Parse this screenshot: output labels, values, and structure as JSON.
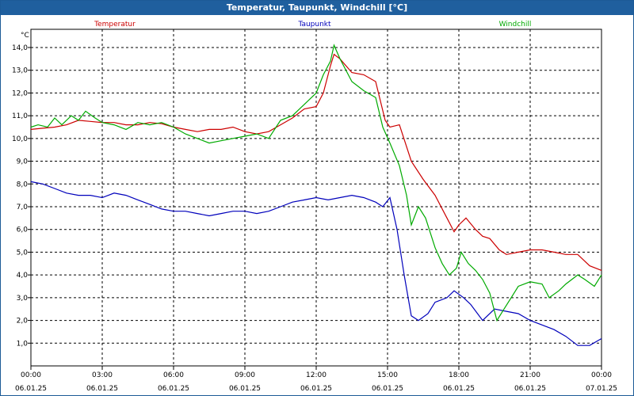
{
  "window": {
    "title": "Temperatur, Taupunkt, Windchill [°C]"
  },
  "chart_data": {
    "type": "line",
    "title": "Temperatur, Taupunkt, Windchill [°C]",
    "ylabel": "°C",
    "ylim": [
      0,
      14.8
    ],
    "xlim": [
      0,
      24
    ],
    "grid": true,
    "legend_placement": "top",
    "x_ticks": [
      {
        "hour": 0,
        "time": "00:00",
        "date": "06.01.25"
      },
      {
        "hour": 3,
        "time": "03:00",
        "date": "06.01.25"
      },
      {
        "hour": 6,
        "time": "06:00",
        "date": "06.01.25"
      },
      {
        "hour": 9,
        "time": "09:00",
        "date": "06.01.25"
      },
      {
        "hour": 12,
        "time": "12:00",
        "date": "06.01.25"
      },
      {
        "hour": 15,
        "time": "15:00",
        "date": "06.01.25"
      },
      {
        "hour": 18,
        "time": "18:00",
        "date": "06.01.25"
      },
      {
        "hour": 21,
        "time": "21:00",
        "date": "06.01.25"
      },
      {
        "hour": 24,
        "time": "00:00",
        "date": "07.01.25"
      }
    ],
    "y_ticks": [
      "1,0",
      "2,0",
      "3,0",
      "4,0",
      "5,0",
      "6,0",
      "7,0",
      "8,0",
      "9,0",
      "10,0",
      "11,0",
      "12,0",
      "13,0",
      "14,0"
    ],
    "series": [
      {
        "name": "Temperatur",
        "color": "#cc0000",
        "points": [
          [
            0,
            10.4
          ],
          [
            0.5,
            10.45
          ],
          [
            1,
            10.5
          ],
          [
            1.5,
            10.6
          ],
          [
            2,
            10.8
          ],
          [
            2.5,
            10.75
          ],
          [
            3,
            10.7
          ],
          [
            3.5,
            10.7
          ],
          [
            4,
            10.6
          ],
          [
            4.5,
            10.6
          ],
          [
            5,
            10.7
          ],
          [
            5.5,
            10.65
          ],
          [
            6,
            10.5
          ],
          [
            6.5,
            10.4
          ],
          [
            7,
            10.3
          ],
          [
            7.5,
            10.4
          ],
          [
            8,
            10.4
          ],
          [
            8.5,
            10.5
          ],
          [
            9,
            10.3
          ],
          [
            9.5,
            10.2
          ],
          [
            10,
            10.3
          ],
          [
            10.5,
            10.6
          ],
          [
            11,
            10.9
          ],
          [
            11.5,
            11.3
          ],
          [
            12,
            11.4
          ],
          [
            12.3,
            12.0
          ],
          [
            12.6,
            13.2
          ],
          [
            12.75,
            13.7
          ],
          [
            13,
            13.5
          ],
          [
            13.5,
            12.9
          ],
          [
            14,
            12.8
          ],
          [
            14.5,
            12.5
          ],
          [
            14.9,
            10.8
          ],
          [
            15.1,
            10.5
          ],
          [
            15.5,
            10.6
          ],
          [
            16,
            9.0
          ],
          [
            16.5,
            8.2
          ],
          [
            17,
            7.5
          ],
          [
            17.5,
            6.5
          ],
          [
            17.8,
            5.9
          ],
          [
            18,
            6.2
          ],
          [
            18.3,
            6.5
          ],
          [
            18.7,
            6.0
          ],
          [
            19,
            5.7
          ],
          [
            19.3,
            5.6
          ],
          [
            19.7,
            5.1
          ],
          [
            20,
            4.9
          ],
          [
            20.5,
            5.0
          ],
          [
            21,
            5.1
          ],
          [
            21.5,
            5.1
          ],
          [
            22,
            5.0
          ],
          [
            22.5,
            4.9
          ],
          [
            23,
            4.9
          ],
          [
            23.5,
            4.4
          ],
          [
            24,
            4.2
          ]
        ]
      },
      {
        "name": "Taupunkt",
        "color": "#0000bb",
        "points": [
          [
            0,
            8.1
          ],
          [
            0.5,
            8.0
          ],
          [
            1,
            7.8
          ],
          [
            1.5,
            7.6
          ],
          [
            2,
            7.5
          ],
          [
            2.5,
            7.5
          ],
          [
            3,
            7.4
          ],
          [
            3.5,
            7.6
          ],
          [
            4,
            7.5
          ],
          [
            4.5,
            7.3
          ],
          [
            5,
            7.1
          ],
          [
            5.5,
            6.9
          ],
          [
            6,
            6.8
          ],
          [
            6.5,
            6.8
          ],
          [
            7,
            6.7
          ],
          [
            7.5,
            6.6
          ],
          [
            8,
            6.7
          ],
          [
            8.5,
            6.8
          ],
          [
            9,
            6.8
          ],
          [
            9.5,
            6.7
          ],
          [
            10,
            6.8
          ],
          [
            10.5,
            7.0
          ],
          [
            11,
            7.2
          ],
          [
            11.5,
            7.3
          ],
          [
            12,
            7.4
          ],
          [
            12.5,
            7.3
          ],
          [
            13,
            7.4
          ],
          [
            13.5,
            7.5
          ],
          [
            14,
            7.4
          ],
          [
            14.5,
            7.2
          ],
          [
            14.8,
            7.0
          ],
          [
            15.1,
            7.4
          ],
          [
            15.4,
            6.0
          ],
          [
            15.7,
            4.0
          ],
          [
            16,
            2.2
          ],
          [
            16.3,
            2.0
          ],
          [
            16.7,
            2.3
          ],
          [
            17,
            2.8
          ],
          [
            17.5,
            3.0
          ],
          [
            17.8,
            3.3
          ],
          [
            18.2,
            3.0
          ],
          [
            18.5,
            2.7
          ],
          [
            19,
            2.0
          ],
          [
            19.5,
            2.5
          ],
          [
            20,
            2.4
          ],
          [
            20.5,
            2.3
          ],
          [
            21,
            2.0
          ],
          [
            21.5,
            1.8
          ],
          [
            22,
            1.6
          ],
          [
            22.5,
            1.3
          ],
          [
            23,
            0.9
          ],
          [
            23.5,
            0.9
          ],
          [
            24,
            1.2
          ]
        ]
      },
      {
        "name": "Windchill",
        "color": "#00aa00",
        "points": [
          [
            0,
            10.5
          ],
          [
            0.3,
            10.6
          ],
          [
            0.7,
            10.5
          ],
          [
            1,
            10.9
          ],
          [
            1.3,
            10.6
          ],
          [
            1.7,
            11.0
          ],
          [
            2,
            10.8
          ],
          [
            2.3,
            11.2
          ],
          [
            2.7,
            10.9
          ],
          [
            3,
            10.7
          ],
          [
            3.5,
            10.6
          ],
          [
            4,
            10.4
          ],
          [
            4.5,
            10.7
          ],
          [
            5,
            10.6
          ],
          [
            5.5,
            10.7
          ],
          [
            6,
            10.5
          ],
          [
            6.5,
            10.2
          ],
          [
            7,
            10.0
          ],
          [
            7.5,
            9.8
          ],
          [
            8,
            9.9
          ],
          [
            8.5,
            10.0
          ],
          [
            9,
            10.1
          ],
          [
            9.5,
            10.2
          ],
          [
            10,
            10.0
          ],
          [
            10.5,
            10.8
          ],
          [
            11,
            11.0
          ],
          [
            11.5,
            11.5
          ],
          [
            12,
            12.0
          ],
          [
            12.3,
            12.8
          ],
          [
            12.6,
            13.4
          ],
          [
            12.75,
            14.1
          ],
          [
            13,
            13.5
          ],
          [
            13.5,
            12.5
          ],
          [
            14,
            12.1
          ],
          [
            14.5,
            11.8
          ],
          [
            14.8,
            10.5
          ],
          [
            15.1,
            9.8
          ],
          [
            15.5,
            8.8
          ],
          [
            15.8,
            7.5
          ],
          [
            16,
            6.2
          ],
          [
            16.3,
            7.0
          ],
          [
            16.6,
            6.5
          ],
          [
            17,
            5.2
          ],
          [
            17.3,
            4.5
          ],
          [
            17.6,
            4.0
          ],
          [
            17.9,
            4.3
          ],
          [
            18.1,
            5.0
          ],
          [
            18.4,
            4.5
          ],
          [
            18.7,
            4.2
          ],
          [
            19,
            3.8
          ],
          [
            19.3,
            3.2
          ],
          [
            19.6,
            2.0
          ],
          [
            19.9,
            2.5
          ],
          [
            20.2,
            3.0
          ],
          [
            20.5,
            3.5
          ],
          [
            21,
            3.7
          ],
          [
            21.5,
            3.6
          ],
          [
            21.8,
            3.0
          ],
          [
            22.2,
            3.3
          ],
          [
            22.5,
            3.6
          ],
          [
            23,
            4.0
          ],
          [
            23.3,
            3.8
          ],
          [
            23.7,
            3.5
          ],
          [
            24,
            4.0
          ]
        ]
      }
    ]
  }
}
